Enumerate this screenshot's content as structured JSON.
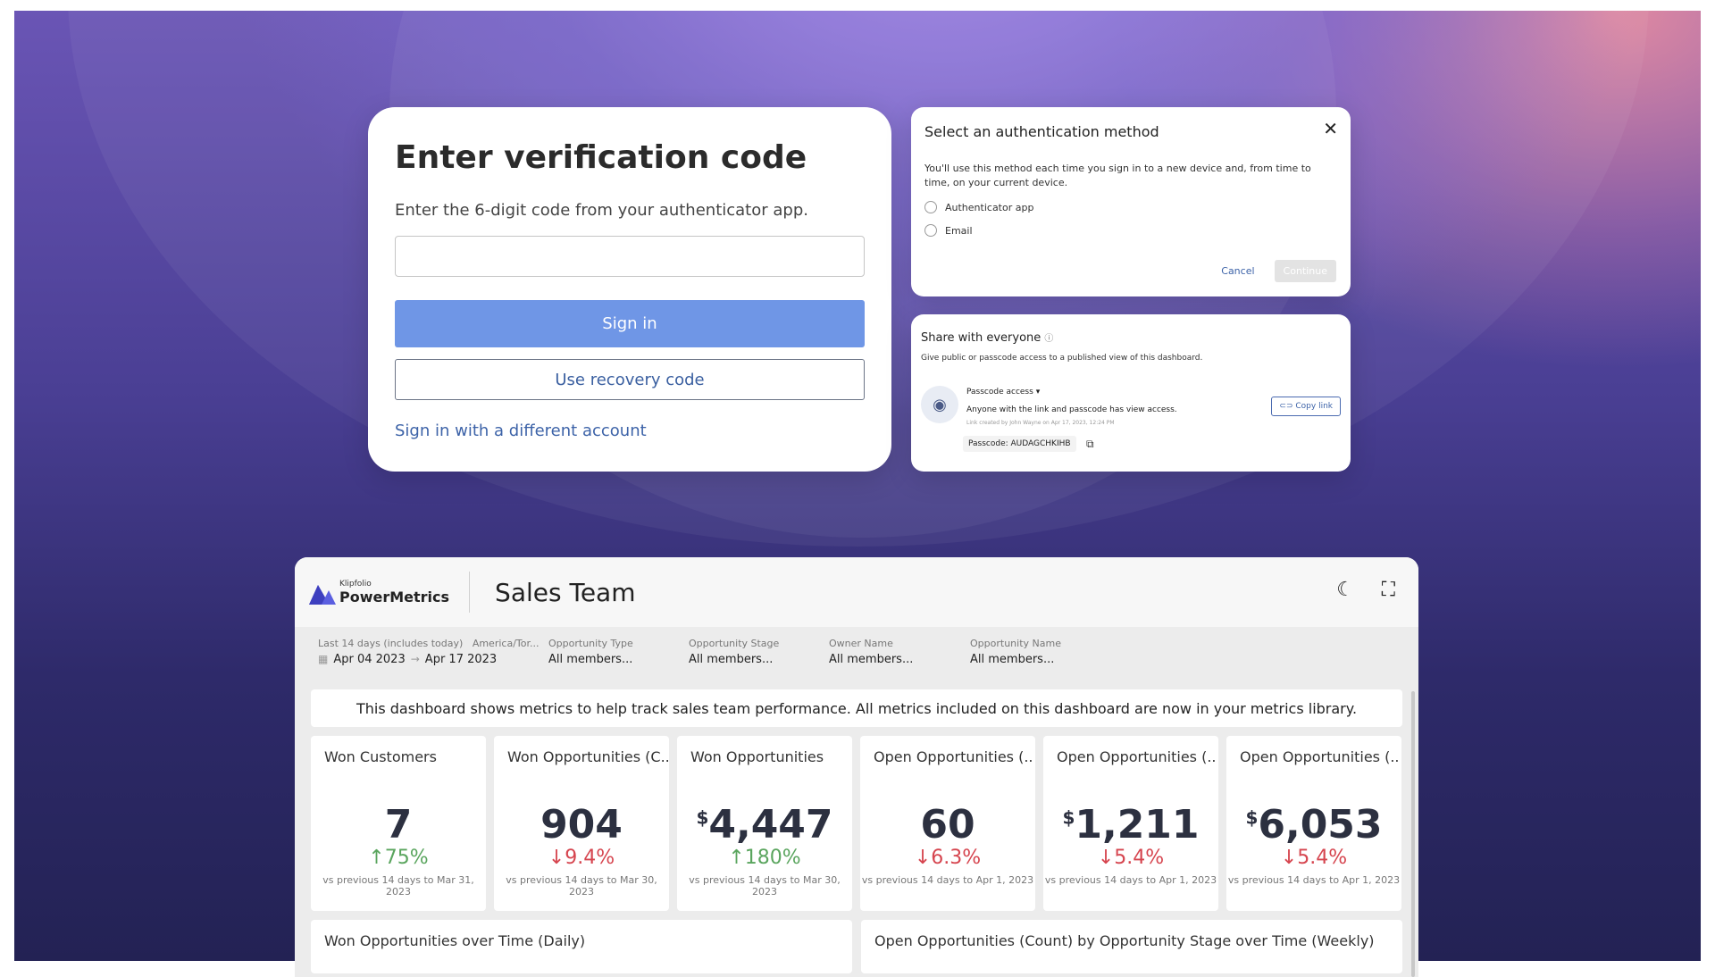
{
  "verify": {
    "title": "Enter verification code",
    "subtitle": "Enter the 6-digit code from your authenticator app.",
    "code_value": "",
    "sign_in_label": "Sign in",
    "recovery_label": "Use recovery code",
    "different_account_label": "Sign in with a different account"
  },
  "auth": {
    "title": "Select an authentication method",
    "description": "You'll use this method each time you sign in to a new device and, from time to time, on your current device.",
    "options": [
      "Authenticator app",
      "Email"
    ],
    "cancel_label": "Cancel",
    "continue_label": "Continue"
  },
  "share": {
    "title": "Share with everyone",
    "description": "Give public or passcode access to a published view of this dashboard.",
    "access_label": "Passcode access",
    "access_desc": "Anyone with the link and passcode has view access.",
    "meta": "Link created by John Wayne on Apr 17, 2023, 12:24 PM",
    "passcode": "Passcode:  AUDAGCHKIHB",
    "copy_link_label": "Copy link"
  },
  "dashboard": {
    "logo_small": "Klipfolio",
    "logo_big": "PowerMetrics",
    "title": "Sales Team",
    "filters": {
      "date_label": "Last 14 days (includes today)",
      "tz_label": "America/Tor...",
      "date_from": "Apr 04 2023",
      "date_to": "Apr 17 2023",
      "opp_type_label": "Opportunity Type",
      "opp_type_val": "All members...",
      "opp_stage_label": "Opportunity Stage",
      "opp_stage_val": "All members...",
      "owner_label": "Owner Name",
      "owner_val": "All members...",
      "opp_name_label": "Opportunity Name",
      "opp_name_val": "All members..."
    },
    "banner": "This dashboard shows metrics to help track sales team performance. All metrics included on this dashboard are now in your metrics library.",
    "kpis": [
      {
        "title": "Won Customers",
        "currency": "",
        "value": "7",
        "change": "75%",
        "arrow": "↑",
        "vs": "vs previous 14 days to Mar 31, 2023"
      },
      {
        "title": "Won Opportunities (C...",
        "currency": "",
        "value": "904",
        "change": "9.4%",
        "arrow": "↓",
        "vs": "vs previous 14 days to Mar 30, 2023"
      },
      {
        "title": "Won Opportunities",
        "currency": "$",
        "value": "4,447",
        "change": "180%",
        "arrow": "↑",
        "vs": "vs previous 14 days to Mar 30, 2023"
      },
      {
        "title": "Open Opportunities (...",
        "currency": "",
        "value": "60",
        "change": "6.3%",
        "arrow": "↓",
        "vs": "vs previous 14 days to Apr 1, 2023"
      },
      {
        "title": "Open Opportunities (...",
        "currency": "$",
        "value": "1,211",
        "change": "5.4%",
        "arrow": "↓",
        "vs": "vs previous 14 days to Apr 1, 2023"
      },
      {
        "title": "Open Opportunities (...",
        "currency": "$",
        "value": "6,053",
        "change": "5.4%",
        "arrow": "↓",
        "vs": "vs previous 14 days to Apr 1, 2023"
      }
    ],
    "charts": [
      "Won Opportunities over Time (Daily)",
      "Open Opportunities (Count) by Opportunity Stage over Time (Weekly)"
    ]
  },
  "colors": {
    "up": "#5aa55e",
    "down": "#d6454f",
    "primary": "#6f96e6"
  }
}
